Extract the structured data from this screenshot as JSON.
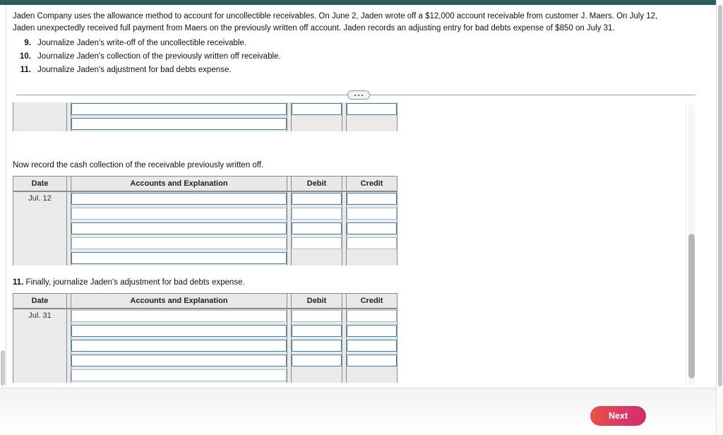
{
  "question": {
    "intro": "Jaden Company uses the allowance method to account for uncollectible receivables. On June 2, Jaden wrote off a $12,000 account receivable from customer J. Maers. On July 12, Jaden unexpectedly received full payment from Maers on the previously written off account. Jaden records an adjusting entry for bad debts expense of $850 on July 31.",
    "requirements": [
      {
        "num": "9.",
        "text": "Journalize Jaden's write-off of the uncollectible receivable."
      },
      {
        "num": "10.",
        "text": "Journalize Jaden's collection of the previously written off receivable."
      },
      {
        "num": "11.",
        "text": "Journalize Jaden's adjustment for bad debts expense."
      }
    ]
  },
  "divider": {
    "expand_label": "•••"
  },
  "columns": {
    "date": "Date",
    "accounts": "Accounts and Explanation",
    "debit": "Debit",
    "credit": "Credit"
  },
  "journals": [
    {
      "id": "journal-write-off",
      "caption": "",
      "date": "",
      "rows": [
        {
          "accounts_value": "",
          "debit_value": "",
          "credit_value": "",
          "has_debit": true,
          "has_credit": true
        },
        {
          "accounts_value": "",
          "debit_value": "",
          "credit_value": "",
          "has_debit": true,
          "has_credit": true
        },
        {
          "accounts_value": "",
          "debit_value": "",
          "credit_value": "",
          "has_debit": false,
          "has_credit": false
        }
      ]
    },
    {
      "id": "journal-collection",
      "caption": "Now record the cash collection of the receivable previously written off.",
      "caption_bold_prefix": "",
      "date": "Jul. 12",
      "rows": [
        {
          "accounts_value": "",
          "debit_value": "",
          "credit_value": "",
          "has_debit": true,
          "has_credit": true
        },
        {
          "accounts_value": "",
          "debit_value": "",
          "credit_value": "",
          "has_debit": true,
          "has_credit": true
        },
        {
          "accounts_value": "",
          "debit_value": "",
          "credit_value": "",
          "has_debit": true,
          "has_credit": true
        },
        {
          "accounts_value": "",
          "debit_value": "",
          "credit_value": "",
          "has_debit": true,
          "has_credit": true
        },
        {
          "accounts_value": "",
          "debit_value": "",
          "credit_value": "",
          "has_debit": false,
          "has_credit": false
        }
      ]
    },
    {
      "id": "journal-bad-debts",
      "caption": " Finally, journalize Jaden's adjustment for bad debts expense.",
      "caption_bold_prefix": "11.",
      "date": "Jul. 31",
      "rows": [
        {
          "accounts_value": "",
          "debit_value": "",
          "credit_value": "",
          "has_debit": true,
          "has_credit": true
        },
        {
          "accounts_value": "",
          "debit_value": "",
          "credit_value": "",
          "has_debit": true,
          "has_credit": true
        },
        {
          "accounts_value": "",
          "debit_value": "",
          "credit_value": "",
          "has_debit": true,
          "has_credit": true
        },
        {
          "accounts_value": "",
          "debit_value": "",
          "credit_value": "",
          "has_debit": true,
          "has_credit": true
        },
        {
          "accounts_value": "",
          "debit_value": "",
          "credit_value": "",
          "has_debit": false,
          "has_credit": false
        }
      ]
    }
  ],
  "footer": {
    "next_label": "Next"
  },
  "colors": {
    "top_bar": "#2b5f5b",
    "next_button_start": "#e8543f",
    "next_button_end": "#cf2d6f",
    "input_border": "#3f7fa5",
    "table_header_bg": "#e8e8e8"
  }
}
